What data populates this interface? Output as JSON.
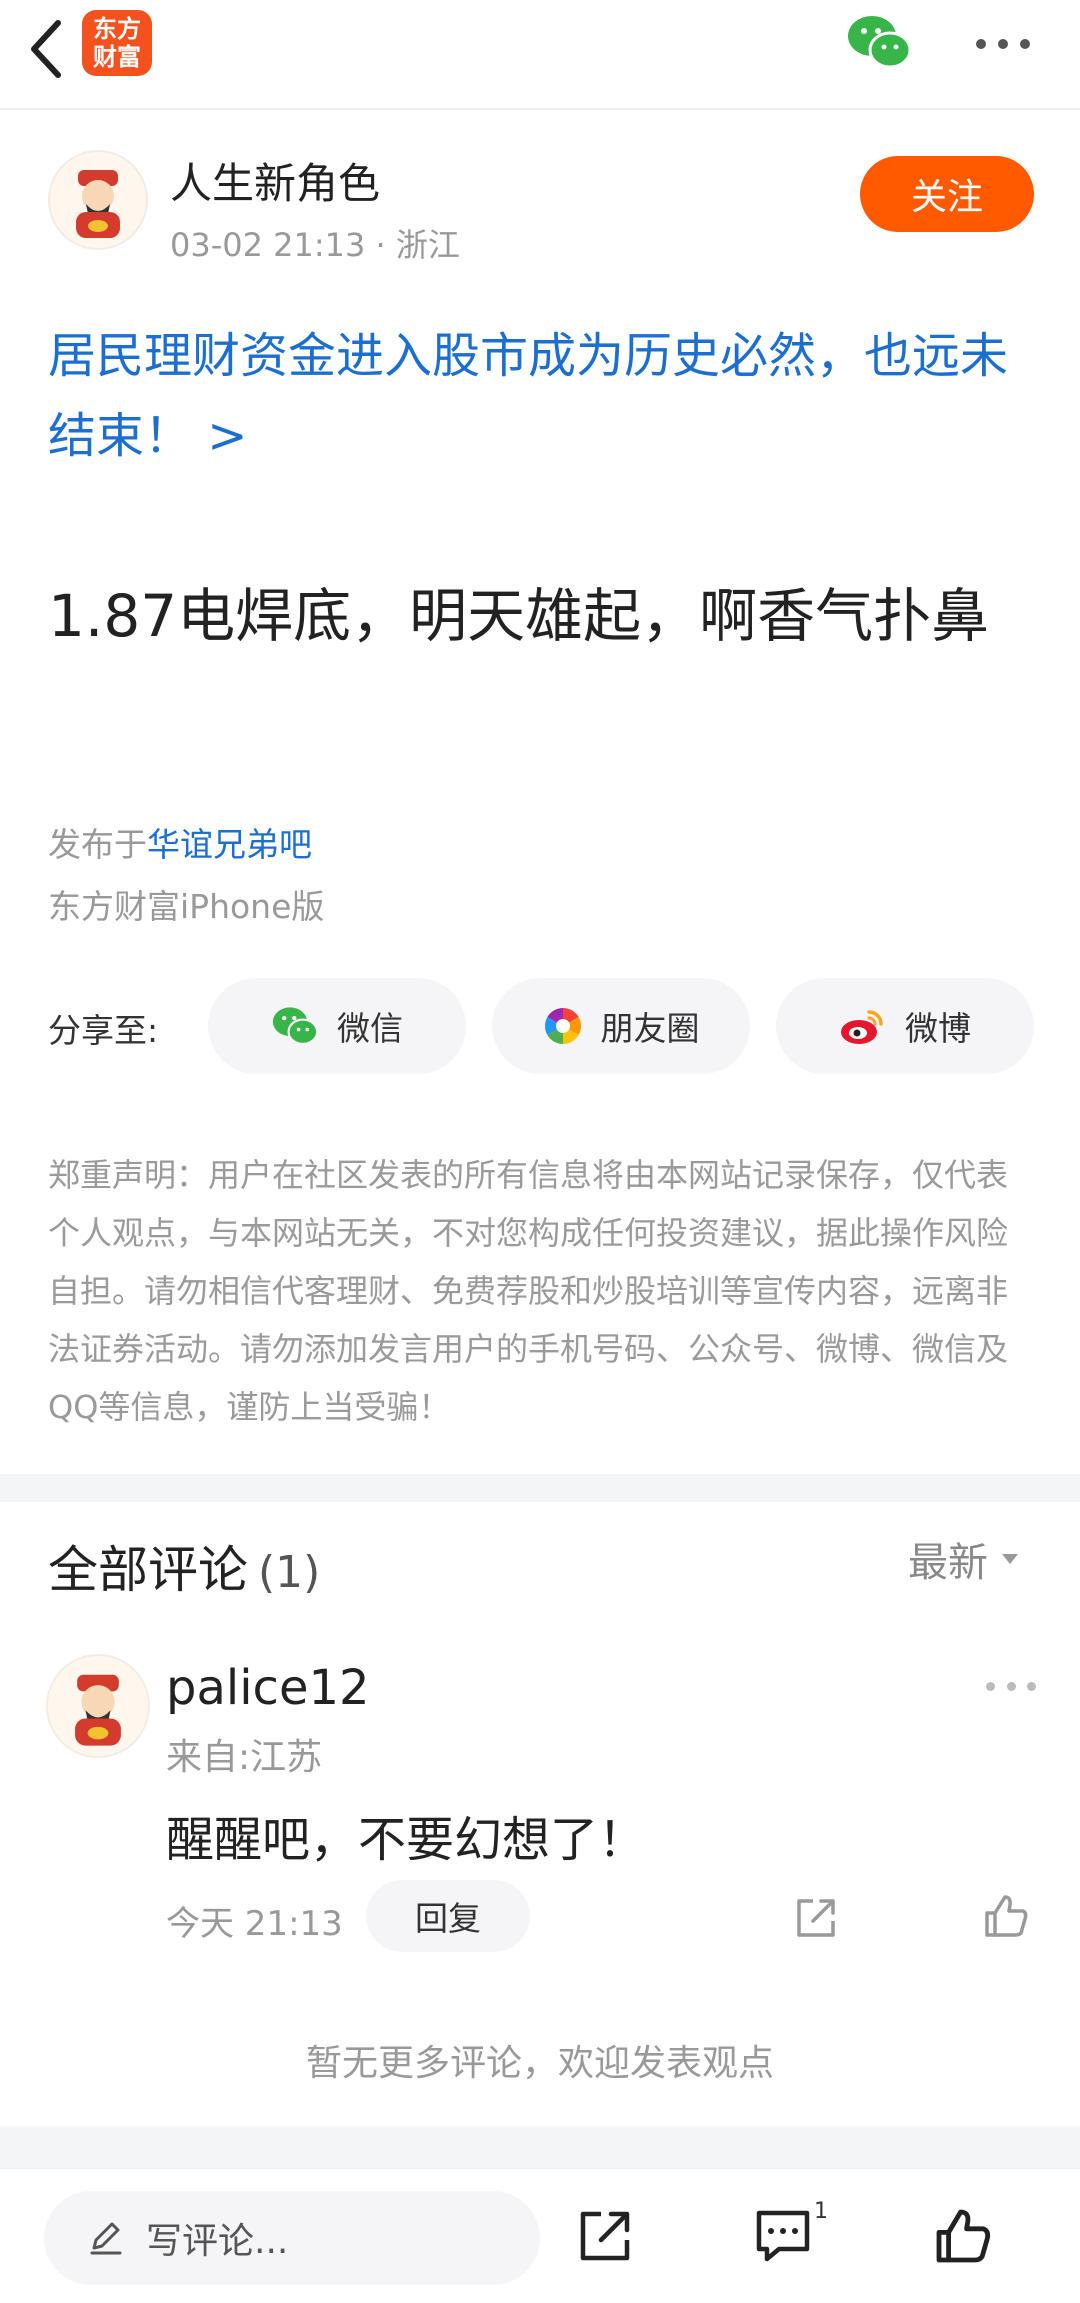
{
  "topbar": {
    "logo_line1": "东方",
    "logo_line2": "财富",
    "back_icon": "chevron-left-icon",
    "share_icon": "wechat-icon",
    "more_icon": "more-horizontal-icon"
  },
  "author": {
    "name": "人生新角色",
    "time": "03-02 21:13",
    "location": "· 浙江",
    "follow_label": "关注"
  },
  "headline_link": "居民理财资金进入股市成为历史必然，也远未结束！ >",
  "post_body": "1.87电焊底，明天雄起，啊香气扑鼻",
  "published": {
    "prefix": "发布于",
    "forum": "华谊兄弟吧",
    "client": "东方财富iPhone版"
  },
  "share": {
    "label": "分享至:",
    "targets": [
      {
        "label": "微信",
        "icon": "wechat-icon"
      },
      {
        "label": "朋友圈",
        "icon": "moments-icon"
      },
      {
        "label": "微博",
        "icon": "weibo-icon"
      }
    ]
  },
  "disclaimer": "郑重声明：用户在社区发表的所有信息将由本网站记录保存，仅代表个人观点，与本网站无关，不对您构成任何投资建议，据此操作风险自担。请勿相信代客理财、免费荐股和炒股培训等宣传内容，远离非法证券活动。请勿添加发言用户的手机号码、公众号、微博、微信及QQ等信息，谨防上当受骗！",
  "comments": {
    "title": "全部评论",
    "count": "(1)",
    "sort_label": "最新",
    "items": [
      {
        "user": "palice12",
        "location": "来自:江苏",
        "text": "醒醒吧，不要幻想了！",
        "time": "今天 21:13",
        "reply_label": "回复"
      }
    ],
    "no_more": "暂无更多评论，欢迎发表观点"
  },
  "bottombar": {
    "write_placeholder": "写评论...",
    "comment_badge": "1"
  },
  "colors": {
    "accent": "#ff5a00",
    "link": "#1c6fd1",
    "logo": "#f4511e"
  }
}
